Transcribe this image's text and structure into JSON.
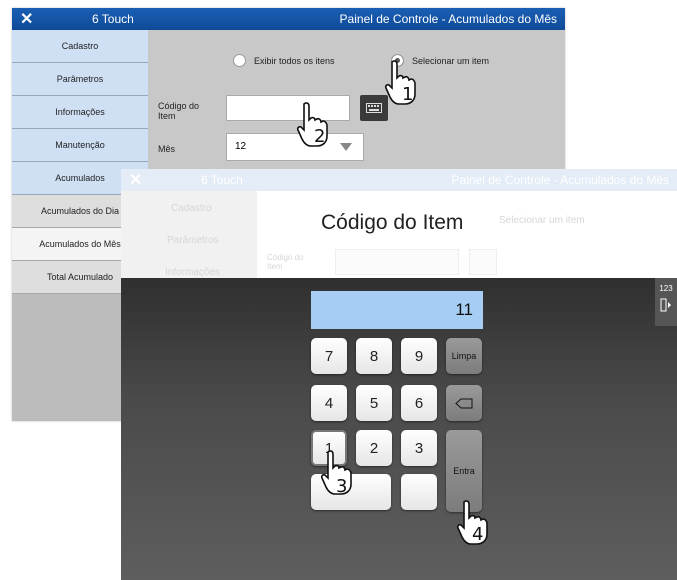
{
  "back_window": {
    "app_name": "6 Touch",
    "title": "Painel de Controle - Acumulados do Mês",
    "sidebar": [
      "Cadastro",
      "Parâmetros",
      "Informações",
      "Manutenção",
      "Acumulados"
    ],
    "subitems": [
      "Acumulados do Dia",
      "Acumulados do Mês",
      "Total Acumulado"
    ],
    "active_subitem": "Acumulados do Mês",
    "radio_all": "Exibir todos os itens",
    "radio_one": "Selecionar um item",
    "item_label": "Código do Item",
    "month_label": "Mês",
    "month_value": "12"
  },
  "front_window": {
    "app_name": "6 Touch",
    "title": "Painel de Controle - Acumulados do Mês",
    "ghost_sidebar": [
      "Cadastro",
      "Parâmetros",
      "Informações"
    ],
    "ghost_radio": "Selecionar um item",
    "ghost_field_label": "Código do Item",
    "modal_title": "Código do Item",
    "display_value": "11",
    "keys": [
      "7",
      "8",
      "9",
      "4",
      "5",
      "6",
      "1",
      "2",
      "3"
    ],
    "clear_label": "Limpa",
    "enter_label": "Entra",
    "side_tab_label": "123"
  },
  "steps": [
    "1",
    "2",
    "3",
    "4"
  ],
  "icons": [
    "close-icon",
    "keyboard-icon",
    "backspace-icon",
    "dropdown-caret-icon",
    "exit-icon",
    "hand-pointer-icon"
  ],
  "colors": {
    "titlebar": "#1a5fb4",
    "sidebar_item": "#cfe0f5",
    "display": "#a6cdf3",
    "keypad_bg": "#3a3a3a"
  }
}
